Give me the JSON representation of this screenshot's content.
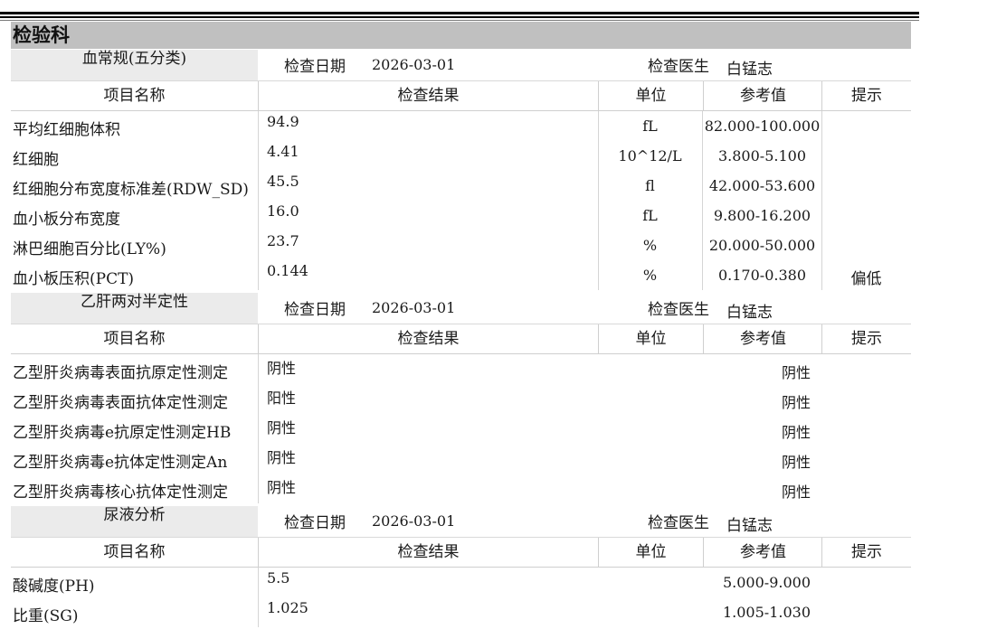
{
  "department": "检验科",
  "labels": {
    "date": "检查日期",
    "doctor": "检查医生",
    "col_name": "项目名称",
    "col_result": "检查结果",
    "col_unit": "单位",
    "col_ref": "参考值",
    "col_hint": "提示"
  },
  "sections": [
    {
      "name": "血常规(五分类)",
      "date": "2026-03-01",
      "doctor": "白锰志",
      "rows": [
        {
          "name": "平均红细胞体积",
          "result": "94.9",
          "unit": "fL",
          "ref": "82.000-100.000",
          "hint": ""
        },
        {
          "name": "红细胞",
          "result": "4.41",
          "unit": "10^12/L",
          "ref": "3.800-5.100",
          "hint": ""
        },
        {
          "name": "红细胞分布宽度标准差(RDW_SD)",
          "result": "45.5",
          "unit": "fl",
          "ref": "42.000-53.600",
          "hint": ""
        },
        {
          "name": "血小板分布宽度",
          "result": "16.0",
          "unit": "fL",
          "ref": "9.800-16.200",
          "hint": ""
        },
        {
          "name": "淋巴细胞百分比(LY%)",
          "result": "23.7",
          "unit": "%",
          "ref": "20.000-50.000",
          "hint": ""
        },
        {
          "name": "血小板压积(PCT)",
          "result": "0.144",
          "unit": "%",
          "ref": "0.170-0.380",
          "hint": "偏低"
        }
      ]
    },
    {
      "name": "乙肝两对半定性",
      "date": "2026-03-01",
      "doctor": "白锰志",
      "rows": [
        {
          "name": "乙型肝炎病毒表面抗原定性测定",
          "result": "阴性",
          "unit": "",
          "ref": "阴性",
          "hint": ""
        },
        {
          "name": "乙型肝炎病毒表面抗体定性测定",
          "result": "阳性",
          "unit": "",
          "ref": "阴性",
          "hint": ""
        },
        {
          "name": "乙型肝炎病毒e抗原定性测定HB",
          "result": "阴性",
          "unit": "",
          "ref": "阴性",
          "hint": ""
        },
        {
          "name": "乙型肝炎病毒e抗体定性测定An",
          "result": "阴性",
          "unit": "",
          "ref": "阴性",
          "hint": ""
        },
        {
          "name": "乙型肝炎病毒核心抗体定性测定",
          "result": "阴性",
          "unit": "",
          "ref": "阴性",
          "hint": ""
        }
      ]
    },
    {
      "name": "尿液分析",
      "date": "2026-03-01",
      "doctor": "白锰志",
      "rows": [
        {
          "name": "酸碱度(PH)",
          "result": "5.5",
          "unit": "",
          "ref": "5.000-9.000",
          "hint": ""
        },
        {
          "name": "比重(SG)",
          "result": "1.025",
          "unit": "",
          "ref": "1.005-1.030",
          "hint": ""
        }
      ]
    }
  ]
}
